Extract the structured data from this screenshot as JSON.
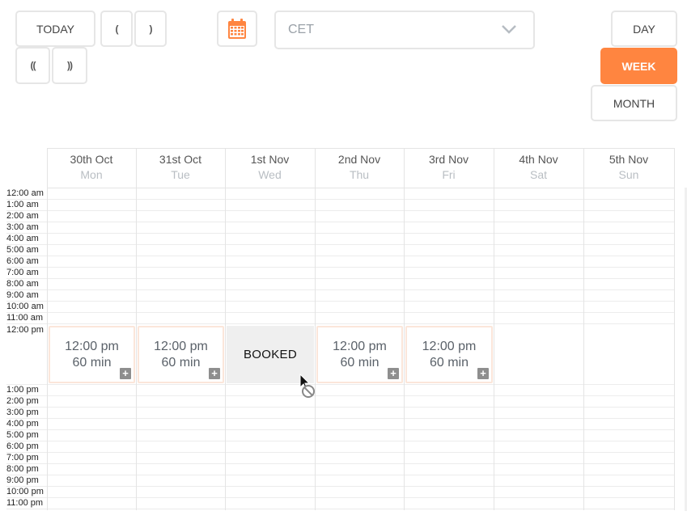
{
  "toolbar": {
    "today_label": "TODAY",
    "prev_label": "(",
    "next_label": ")",
    "prev_fast_label": "((",
    "next_fast_label": "))",
    "timezone_value": "CET",
    "day_label": "DAY",
    "week_label": "WEEK",
    "month_label": "MONTH",
    "active_view": "WEEK"
  },
  "colors": {
    "accent": "#ff8540",
    "slot_border": "#fbe6da",
    "booked_bg": "#efefef"
  },
  "days": [
    {
      "date": "30th Oct",
      "weekday": "Mon"
    },
    {
      "date": "31st Oct",
      "weekday": "Tue"
    },
    {
      "date": "1st Nov",
      "weekday": "Wed"
    },
    {
      "date": "2nd Nov",
      "weekday": "Thu"
    },
    {
      "date": "3rd Nov",
      "weekday": "Fri"
    },
    {
      "date": "4th Nov",
      "weekday": "Sat"
    },
    {
      "date": "5th Nov",
      "weekday": "Sun"
    }
  ],
  "hours": [
    "12:00 am",
    "1:00 am",
    "2:00 am",
    "3:00 am",
    "4:00 am",
    "5:00 am",
    "6:00 am",
    "7:00 am",
    "8:00 am",
    "9:00 am",
    "10:00 am",
    "11:00 am",
    "12:00 pm",
    "1:00 pm",
    "2:00 pm",
    "3:00 pm",
    "4:00 pm",
    "5:00 pm",
    "6:00 pm",
    "7:00 pm",
    "8:00 pm",
    "9:00 pm",
    "10:00 pm",
    "11:00 pm"
  ],
  "slots": [
    {
      "time": "12:00 pm",
      "duration": "60 min",
      "plus": "+"
    },
    {
      "time": "12:00 pm",
      "duration": "60 min",
      "plus": "+"
    },
    {
      "booked": "BOOKED"
    },
    {
      "time": "12:00 pm",
      "duration": "60 min",
      "plus": "+"
    },
    {
      "time": "12:00 pm",
      "duration": "60 min",
      "plus": "+"
    }
  ]
}
